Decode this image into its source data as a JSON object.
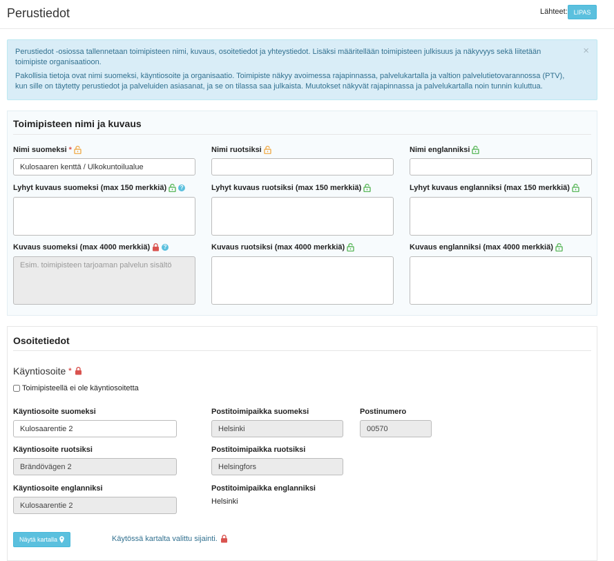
{
  "header": {
    "title": "Perustiedot",
    "sources_label": "Lähteet:",
    "sources_badge": "LIPAS"
  },
  "info": {
    "paragraph1": "Perustiedot -osiossa tallennetaan toimipisteen nimi, kuvaus, osoitetiedot ja yhteystiedot. Lisäksi määritellään toimipisteen julkisuus ja näkyvyys sekä liitetään toimipiste organisaatioon.",
    "paragraph2": "Pakollisia tietoja ovat nimi suomeksi, käyntiosoite ja organisaatio. Toimipiste näkyy avoimessa rajapinnassa, palvelukartalla ja valtion palvelutietovarannossa (PTV), kun sille on täytetty perustiedot ja palveluiden asiasanat, ja se on tilassa saa julkaista. Muutokset näkyvät rajapinnassa ja palvelukartalla noin tunnin kuluttua.",
    "close": "×"
  },
  "names_section": {
    "title": "Toimipisteen nimi ja kuvaus",
    "name_fi": {
      "label": "Nimi suomeksi",
      "required": "*",
      "value": "Kulosaaren kenttä / Ulkokuntoilualue",
      "lock": "lock-open-icon",
      "lock_color": "#f0ad4e"
    },
    "name_sv": {
      "label": "Nimi ruotsiksi",
      "value": "",
      "lock": "lock-open-icon",
      "lock_color": "#f0ad4e"
    },
    "name_en": {
      "label": "Nimi englanniksi",
      "value": "",
      "lock": "lock-open-icon",
      "lock_color": "#5cb85c"
    },
    "short_fi": {
      "label": "Lyhyt kuvaus suomeksi (max 150 merkkiä)",
      "value": "",
      "lock_color": "#5cb85c"
    },
    "short_sv": {
      "label": "Lyhyt kuvaus ruotsiksi (max 150 merkkiä)",
      "value": "",
      "lock_color": "#5cb85c"
    },
    "short_en": {
      "label": "Lyhyt kuvaus englanniksi (max 150 merkkiä)",
      "value": "",
      "lock_color": "#5cb85c"
    },
    "desc_fi": {
      "label": "Kuvaus suomeksi (max 4000 merkkiä)",
      "placeholder": "Esim. toimipisteen tarjoaman palvelun sisältö",
      "lock_color": "#d9534f"
    },
    "desc_sv": {
      "label": "Kuvaus ruotsiksi (max 4000 merkkiä)",
      "value": "",
      "lock_color": "#5cb85c"
    },
    "desc_en": {
      "label": "Kuvaus englanniksi (max 4000 merkkiä)",
      "value": "",
      "lock_color": "#5cb85c"
    }
  },
  "address_section": {
    "title": "Osoitetiedot",
    "visiting_address": {
      "label": "Käyntiosoite",
      "required": "*"
    },
    "no_address_checkbox": "Toimipisteellä ei ole käyntiosoitetta",
    "street_fi": {
      "label": "Käyntiosoite suomeksi",
      "value": "Kulosaarentie 2"
    },
    "city_fi": {
      "label": "Postitoimipaikka suomeksi",
      "value": "Helsinki"
    },
    "postal_code": {
      "label": "Postinumero",
      "value": "00570"
    },
    "street_sv": {
      "label": "Käyntiosoite ruotsiksi",
      "value": "Brändövägen 2"
    },
    "city_sv": {
      "label": "Postitoimipaikka ruotsiksi",
      "value": "Helsingfors"
    },
    "street_en": {
      "label": "Käyntiosoite englanniksi",
      "value": "Kulosaarentie 2"
    },
    "city_en": {
      "label": "Postitoimipaikka englanniksi",
      "value": "Helsinki"
    },
    "map_button": "Näytä kartalla",
    "map_note": "Käytössä kartalta valittu sijainti."
  }
}
